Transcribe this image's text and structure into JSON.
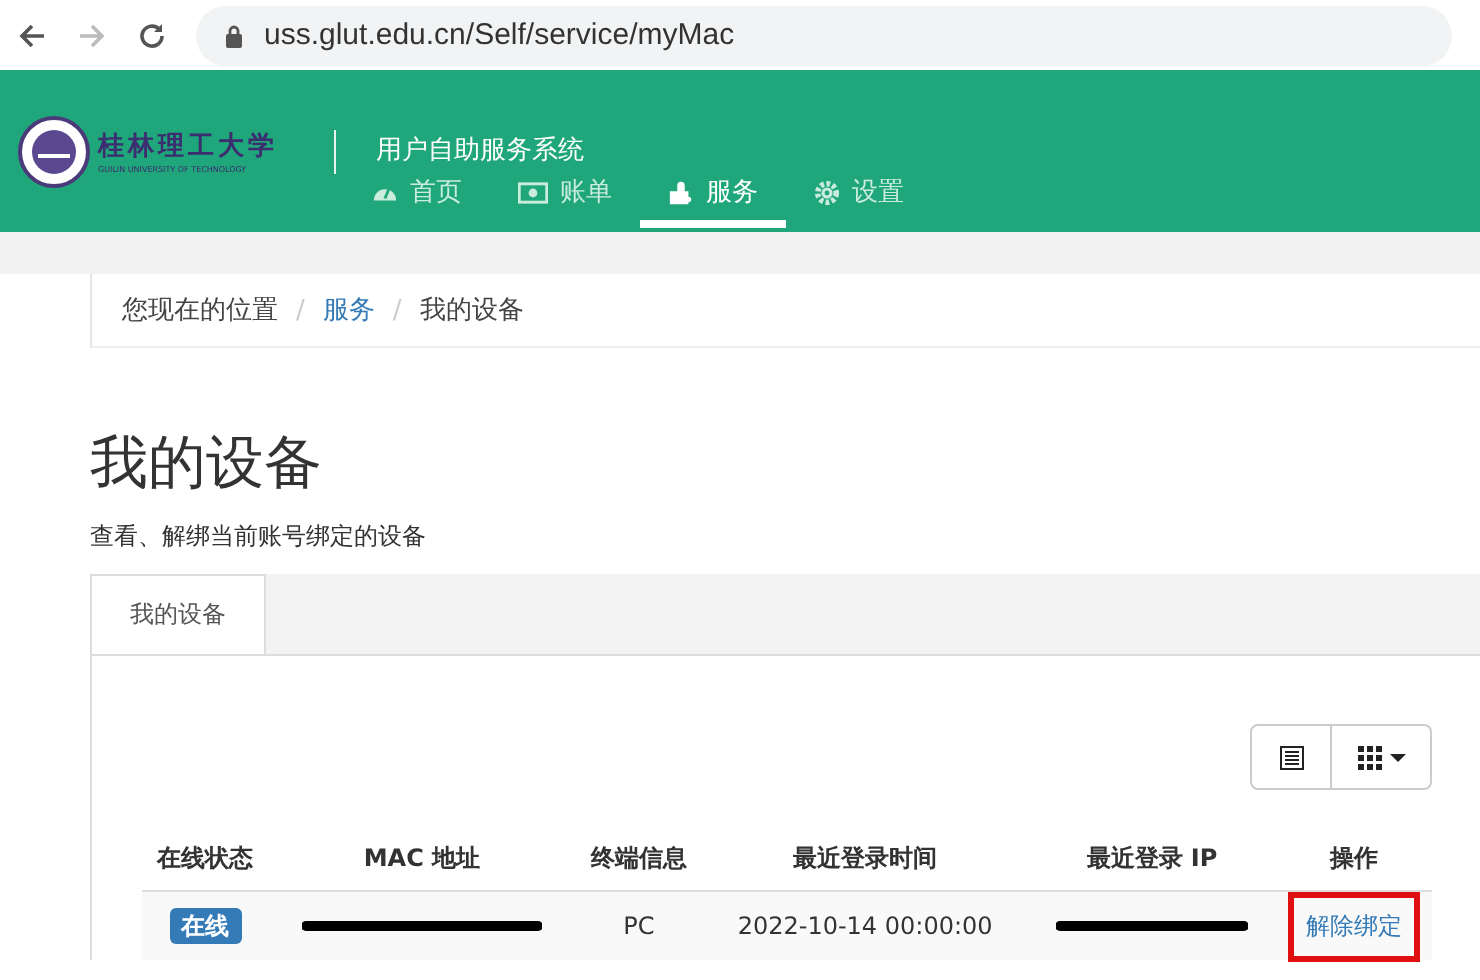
{
  "browser": {
    "url": "uss.glut.edu.cn/Self/service/myMac"
  },
  "header": {
    "logo_name": "桂林理工大学",
    "logo_subtitle": "GUILIN UNIVERSITY OF TECHNOLOGY",
    "system_name": "用户自助服务系统",
    "nav": [
      {
        "label": "首页",
        "selected": false
      },
      {
        "label": "账单",
        "selected": false
      },
      {
        "label": "服务",
        "selected": true
      },
      {
        "label": "设置",
        "selected": false
      }
    ]
  },
  "breadcrumb": [
    {
      "label": "您现在的位置",
      "kind": "text"
    },
    {
      "label": "/",
      "kind": "separator"
    },
    {
      "label": "服务",
      "kind": "link"
    },
    {
      "label": "/",
      "kind": "separator"
    },
    {
      "label": "我的设备",
      "kind": "text"
    }
  ],
  "page": {
    "title": "我的设备",
    "subtitle": "查看、解绑当前账号绑定的设备"
  },
  "tabs": [
    {
      "label": "我的设备",
      "selected": true
    }
  ],
  "table": {
    "columns": [
      "在线状态",
      "MAC 地址",
      "终端信息",
      "最近登录时间",
      "最近登录 IP",
      "操作"
    ],
    "rows": [
      {
        "status": "在线",
        "mac": {
          "kind": "redacted"
        },
        "terminal": "PC",
        "last_login": "2022-10-14 00:00:00",
        "ip": {
          "kind": "redacted"
        },
        "action": {
          "label": "解除绑定",
          "highlighted": true
        }
      }
    ]
  }
}
